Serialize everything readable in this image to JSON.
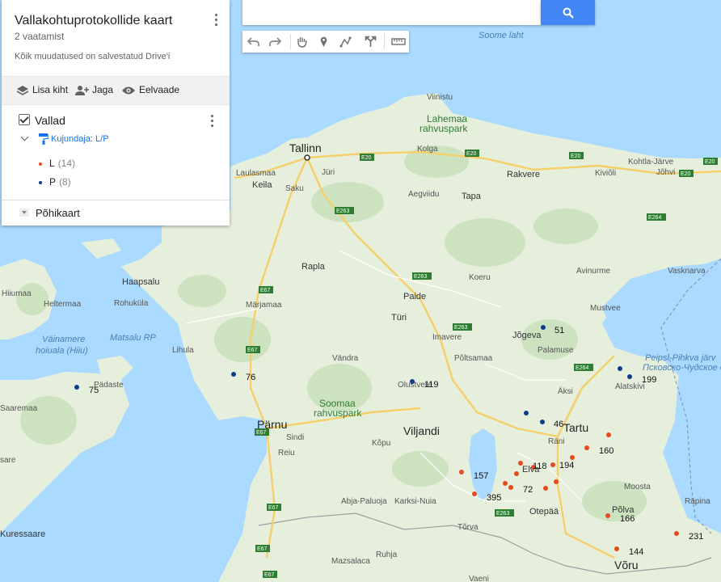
{
  "panel": {
    "title": "Vallakohtuprotokollide kaart",
    "views": "2 vaatamist",
    "saved_status": "Kõik muudatused on salvestatud Drive'i",
    "actions": {
      "add_layer": "Lisa kiht",
      "share": "Jaga",
      "preview": "Eelvaade"
    },
    "layer": {
      "name": "Vallad",
      "style_link": "Kujundaja: L/P",
      "legend": [
        {
          "label": "L",
          "count": "(14)",
          "color": "#e8491d"
        },
        {
          "label": "P",
          "count": "(8)",
          "color": "#0d3c8c"
        }
      ]
    },
    "basemap": "Põhikaart"
  },
  "search": {
    "placeholder": ""
  },
  "toolbar": [
    "undo-icon",
    "redo-icon",
    "pan-hand-icon",
    "marker-icon",
    "draw-line-icon",
    "directions-icon",
    "ruler-icon"
  ],
  "colors": {
    "water": "#aadaff",
    "land": "#e8f0df",
    "forest": "#cfe3c1",
    "road": "#f6d57a",
    "accent": "#4285f4"
  },
  "map_labels": {
    "tallinn": "Tallinn",
    "laulasmaa": "Laulasmaa",
    "keila": "Keila",
    "saku": "Saku",
    "juri": "Jüri",
    "viinistu": "Viinistu",
    "lahemaa1": "Lahemaa",
    "lahemaa2": "rahvuspark",
    "kolga": "Kolga",
    "aegviidu": "Aegviidu",
    "tapa": "Tapa",
    "rakvere": "Rakvere",
    "kohtla": "Kohtla-Järve",
    "kivioli": "Kiviõli",
    "johvi": "Jõhvi",
    "soome_laht": "Soome laht",
    "haapsalu": "Haapsalu",
    "rohukula": "Rohuküla",
    "hiiumaa": "Hiiumaa",
    "heltermaa": "Heltermaa",
    "rapla": "Rapla",
    "marjamaa": "Märjamaa",
    "koeru": "Koeru",
    "paide": "Paide",
    "avinurme": "Avinurme",
    "vasknarva": "Vasknarva",
    "mustvee": "Mustvee",
    "vainamere1": "Väinamere",
    "vainamere2": "hoiuala (Hiiu)",
    "matsalu": "Matsalu RP",
    "lihula": "Lihula",
    "turi": "Türi",
    "imavere": "Imavere",
    "jogeva": "Jõgeva",
    "palamuse": "Palamuse",
    "vandra": "Vändra",
    "poltsamaa": "Põltsamaa",
    "padaste": "Pädaste",
    "saaremaa": "Saaremaa",
    "soomaa1": "Soomaa",
    "soomaa2": "rahvuspark",
    "olustvere": "Olustvere",
    "peipsi1": "Peipsi-Pihkva järv",
    "peipsi2": "Псковско-Чудское о",
    "alatskivi": "Alatskivi",
    "aksi": "Äksi",
    "parnu": "Pärnu",
    "sindi": "Sindi",
    "viljandi": "Viljandi",
    "tartu": "Tartu",
    "ranilo": "Räni",
    "reiu": "Reiu",
    "kopu": "Kõpu",
    "elva": "Elva",
    "abja": "Abja-Paluoja",
    "karksi": "Karksi-Nuia",
    "otepaa": "Otepää",
    "moosta": "Moosta",
    "polva": "Põlva",
    "rapina": "Räpina",
    "torva": "Tõrva",
    "ruhja": "Ruhja",
    "mazsalaca": "Mazsalaca",
    "voru": "Võru",
    "vaeni": "Vaeni",
    "kuressaare": "Kuressaare",
    "kuressaare2": "sare",
    "e20a": "E20",
    "e20b": "E20",
    "e20c": "E20",
    "e20d": "E20",
    "e20e": "E20",
    "e263a": "E263",
    "e263b": "E263",
    "e263c": "E263",
    "e263d": "E263",
    "e264a": "E264",
    "e264b": "E264",
    "e67a": "E67",
    "e67b": "E67",
    "e67c": "E67",
    "e67d": "E67",
    "e67e": "E67",
    "e67f": "E67"
  },
  "markers": [
    {
      "label": "51",
      "type": "P"
    },
    {
      "label": "76",
      "type": "P"
    },
    {
      "label": "75",
      "type": "P"
    },
    {
      "label": "119",
      "type": "P"
    },
    {
      "label": "199",
      "type": "P"
    },
    {
      "label": "46",
      "type": "P"
    },
    {
      "label": "160",
      "type": "L"
    },
    {
      "label": "118",
      "type": "L"
    },
    {
      "label": "194",
      "type": "L"
    },
    {
      "label": "157",
      "type": "L"
    },
    {
      "label": "72",
      "type": "L"
    },
    {
      "label": "395",
      "type": "L"
    },
    {
      "label": "166",
      "type": "L"
    },
    {
      "label": "231",
      "type": "L"
    },
    {
      "label": "144",
      "type": "L"
    }
  ]
}
